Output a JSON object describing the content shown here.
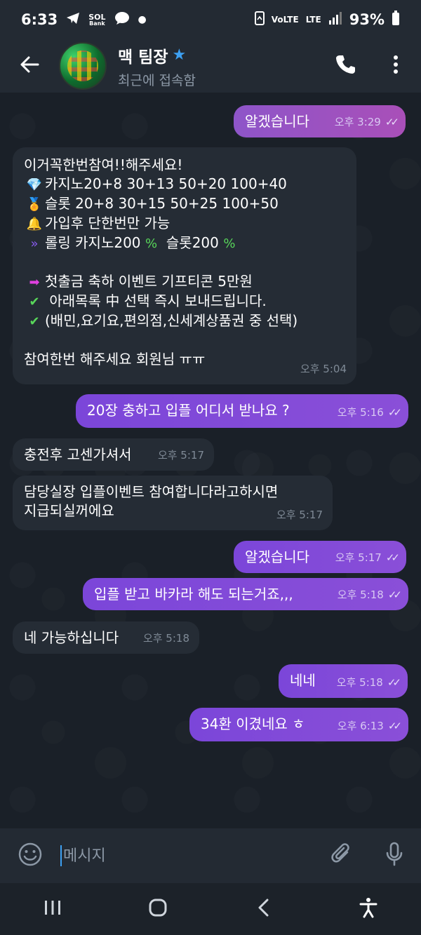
{
  "status_bar": {
    "time": "6:33",
    "sb_bank": "Bank",
    "sb_sol": "SOL",
    "sb_volte": "VoLTE",
    "sb_lte": "LTE",
    "battery": "93%"
  },
  "header": {
    "contact_name": "맥 팀장",
    "last_seen": "최근에 접속함"
  },
  "messages": [
    {
      "text": "알겠습니다",
      "time": "오후 3:29"
    },
    {
      "lines": [
        "이거꼭한번참여!!해주세요!",
        "카지노20+8 30+13 50+20 100+40",
        "슬롯    20+8 30+15 50+25 100+50",
        "가입후 단한번만 가능",
        "롤링 카지노200",
        "슬롯200",
        "첫출금 축하 이벤트  기프티콘 5만원",
        " 아래목록 中 선택 즉시 보내드립니다.",
        "(배민,요기요,편의점,신세계상품권 중 선택)",
        "참여한번 해주세요 회원님 ㅠㅠ"
      ],
      "time": "오후 5:04"
    },
    {
      "text": "20장 충하고 입플 어디서 받나요 ?",
      "time": "오후 5:16"
    },
    {
      "text": "충전후 고센가셔서",
      "time": "오후 5:17"
    },
    {
      "lines": [
        "담당실장 입플이벤트 참여합니다라고하시면",
        "지급되실꺼에요"
      ],
      "time": "오후 5:17"
    },
    {
      "text": "알겠습니다",
      "time": "오후 5:17"
    },
    {
      "text": "입플 받고 바카라 해도 되는거죠,,,",
      "time": "오후 5:18"
    },
    {
      "text": "네 가능하십니다",
      "time": "오후 5:18"
    },
    {
      "text": "네네",
      "time": "오후 5:18"
    },
    {
      "text": "34환 이겼네요 ㅎ",
      "time": "오후 6:13"
    }
  ],
  "input": {
    "placeholder": "메시지"
  },
  "colors": {
    "accent": "#3da0f2",
    "outgoing": "#7b46d9",
    "incoming": "#252c35"
  },
  "icons": [
    "telegram-icon",
    "bank-icon",
    "messenger-icon",
    "back-arrow-icon",
    "verified-star-icon",
    "phone-icon",
    "more-icon",
    "emoji-icon",
    "attach-icon",
    "mic-icon",
    "recent-apps-icon",
    "home-icon",
    "nav-back-icon",
    "accessibility-icon"
  ]
}
